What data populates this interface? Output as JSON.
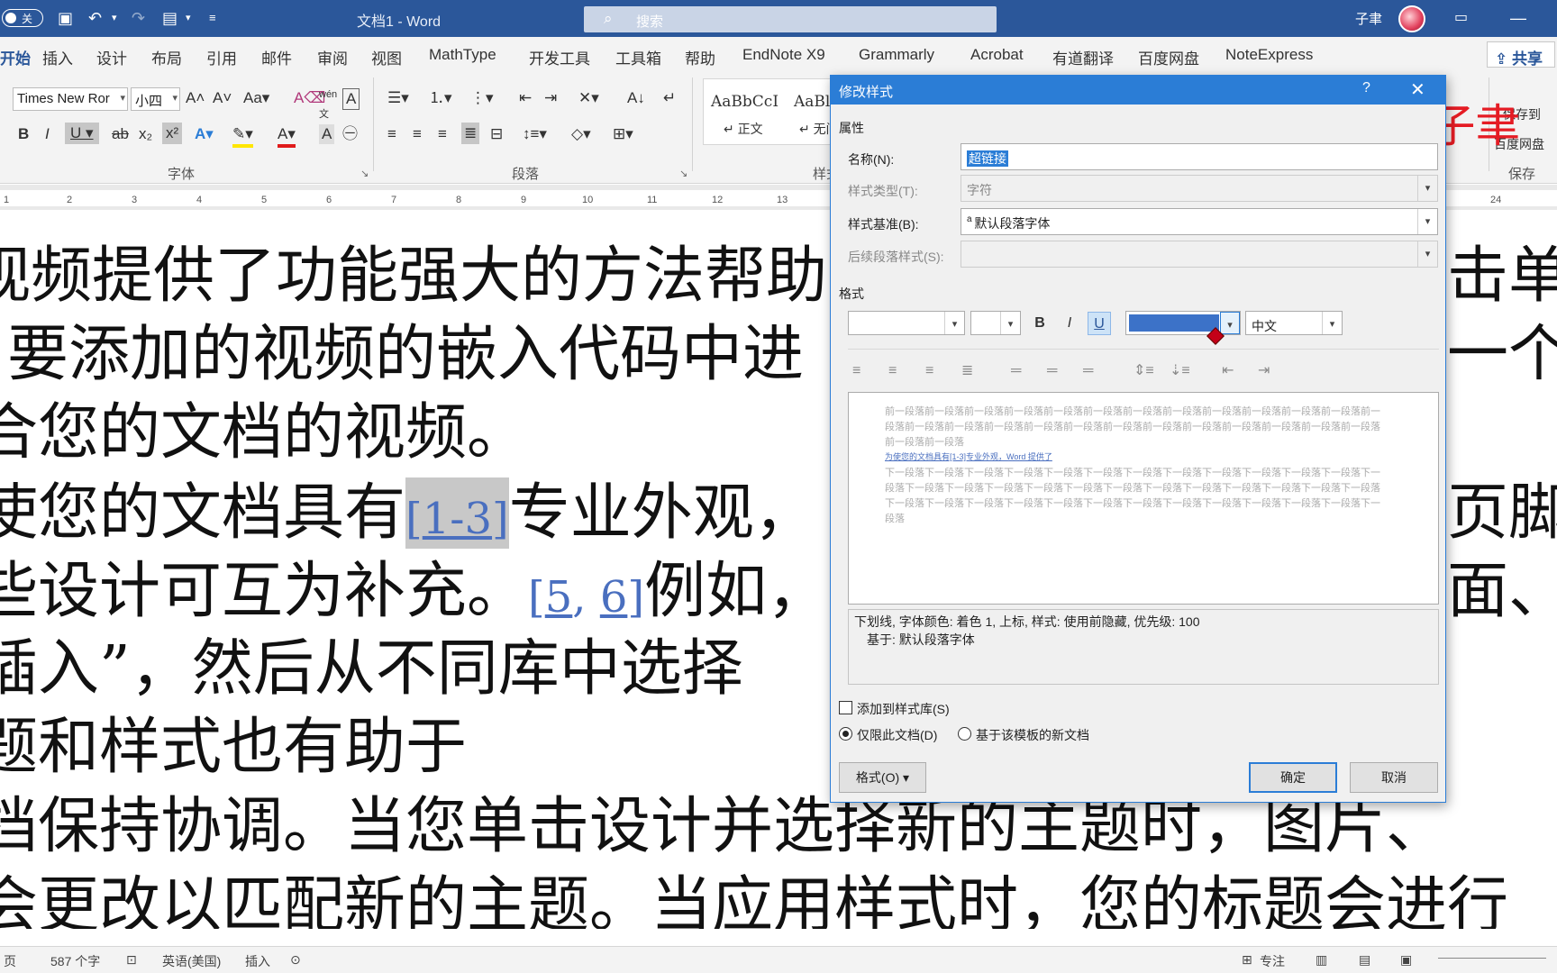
{
  "titlebar": {
    "autosave": "关",
    "doc_title": "文档1  -  Word",
    "search_placeholder": "搜索",
    "user": "子聿"
  },
  "tabs": [
    "开始",
    "插入",
    "设计",
    "布局",
    "引用",
    "邮件",
    "审阅",
    "视图",
    "MathType",
    "开发工具",
    "工具箱",
    "帮助",
    "EndNote X9",
    "Grammarly",
    "Acrobat",
    "有道翻译",
    "百度网盘",
    "NoteExpress"
  ],
  "share_label": "共享",
  "ribbon": {
    "font_name": "Times New Ror",
    "font_size": "小四",
    "group_font": "字体",
    "group_paragraph": "段落",
    "group_styles": "样式",
    "group_save": "保存",
    "style1_sample": "AaBbCcI",
    "style1_name": "↵ 正文",
    "style2_sample": "AaBl",
    "style2_name": "↵ 无间",
    "baidu_save": "百度网盘",
    "save_to": "保存到"
  },
  "ruler_numbers": [
    "1",
    "2",
    "3",
    "4",
    "5",
    "6",
    "7",
    "8",
    "9",
    "10",
    "11",
    "12",
    "13",
    "24"
  ],
  "document": {
    "lines": [
      "视频提供了功能强大的方法帮助",
      "要添加的视频的嵌入代码中进",
      "合您的文档的视频。",
      "使您的文档具有",
      "些设计可互为补充。",
      "插入”，然后从不同库中选择",
      "题和样式也有助于",
      "档保持协调。当您单击设计并选择新的主题时，图片、",
      "会更改以匹配新的主题。当应用样式时，您的标题会进行"
    ],
    "right_fragments": [
      "击单击",
      "一个",
      "页脚",
      "面、",
      "图片、"
    ],
    "line4_after": "专业外观，",
    "line5_after": "例如，",
    "ref1": "1-3",
    "ref2a": "5",
    "ref2b": "6",
    "bracket_open": "[",
    "bracket_close": "]",
    "comma": ", "
  },
  "watermark": "公众号/b站:子聿",
  "dialog": {
    "title": "修改样式",
    "help": "?",
    "section_props": "属性",
    "name_label": "名称(N):",
    "name_value": "超链接",
    "type_label": "样式类型(T):",
    "type_value": "字符",
    "based_label": "样式基准(B):",
    "based_value": "默认段落字体",
    "next_label": "后续段落样式(S):",
    "next_value": "",
    "section_format": "格式",
    "font_value": "",
    "size_value": "",
    "bold": "B",
    "italic": "I",
    "underline": "U",
    "font_color": "#3c72c8",
    "lang_value": "中文",
    "preview_prev": "前一段落前一段落前一段落前一段落前一段落前一段落前一段落前一段落前一段落前一段落前一段落前一段落前一段落前一段落前一段落前一段落前一段落前一段落前一段落前一段落前一段落前一段落前一段落前一段落前一段落前一段落前一段落",
    "preview_sample": "为使您的文档具有[1-3]专业外观，Word 提供了",
    "preview_next": "下一段落下一段落下一段落下一段落下一段落下一段落下一段落下一段落下一段落下一段落下一段落下一段落下一段落下一段落下一段落下一段落下一段落下一段落下一段落下一段落下一段落下一段落下一段落下一段落下一段落下一段落下一段落下一段落下一段落下一段落下一段落下一段落下一段落下一段落下一段落下一段落下一段落下一段落",
    "desc_line1": "下划线, 字体颜色: 着色 1, 上标, 样式: 使用前隐藏, 优先级: 100",
    "desc_line2": "基于: 默认段落字体",
    "add_gallery": "添加到样式库(S)",
    "only_doc": "仅限此文档(D)",
    "new_docs": "基于该模板的新文档",
    "format_btn": "格式(O) ▾",
    "ok": "确定",
    "cancel": "取消"
  },
  "status": {
    "page": "页",
    "words": "587 个字",
    "lang": "英语(美国)",
    "mode": "插入",
    "focus": "专注"
  }
}
